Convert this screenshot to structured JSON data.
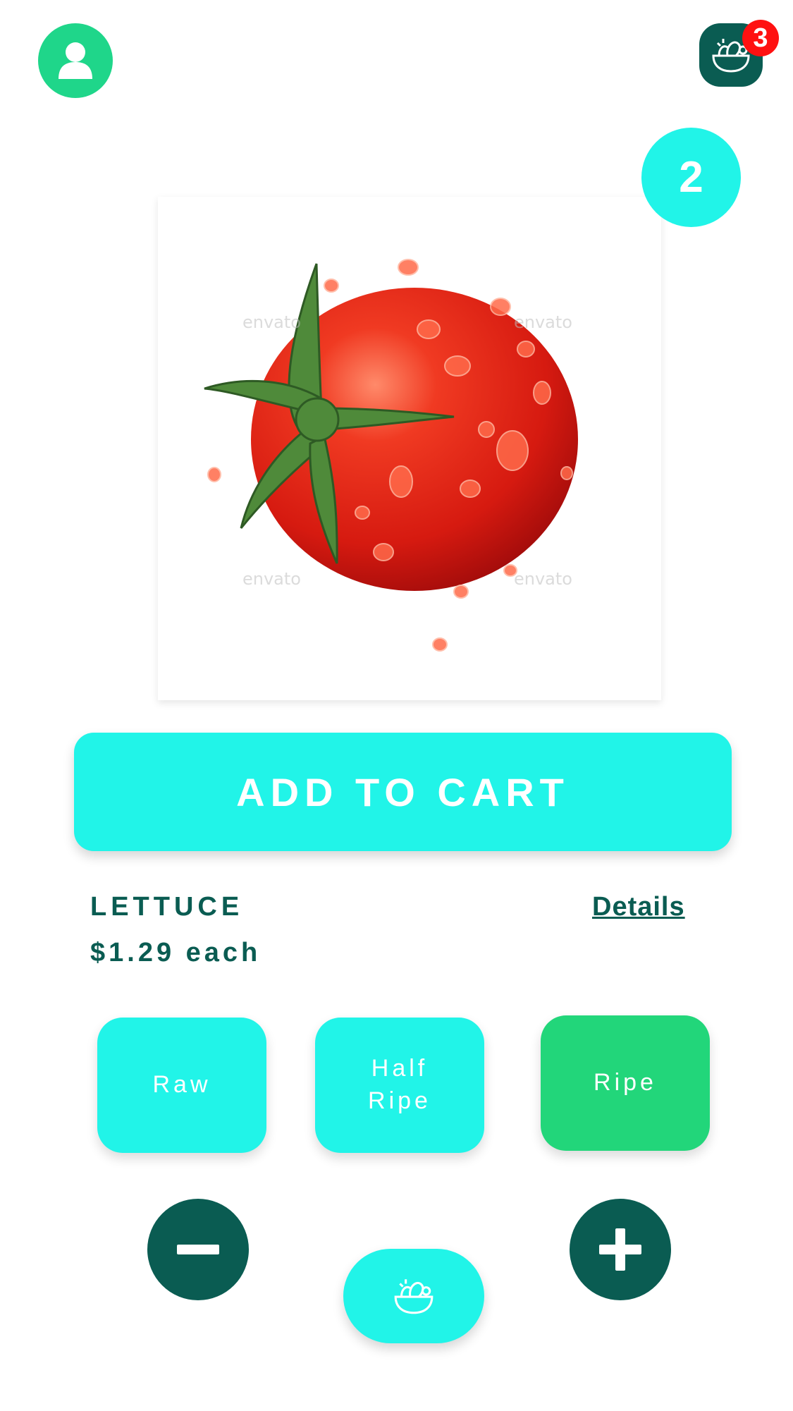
{
  "header": {
    "profile_icon": "user-icon",
    "cart_icon": "salad-bowl-icon",
    "cart_count": "3"
  },
  "product": {
    "image_subject": "tomato",
    "quantity": "2",
    "name": "LETTUCE",
    "price": "$1.29 each",
    "details_label": "Details",
    "watermark": "envato"
  },
  "actions": {
    "add_to_cart_label": "ADD TO CART"
  },
  "ripeness": {
    "options": [
      {
        "label": "Raw",
        "selected": false
      },
      {
        "label": "Half Ripe",
        "selected": false
      },
      {
        "label": "Ripe",
        "selected": true
      }
    ]
  },
  "stepper": {
    "minus_icon": "minus-icon",
    "plus_icon": "plus-icon",
    "fab_icon": "salad-bowl-icon"
  },
  "colors": {
    "accent_cyan": "#21f4e8",
    "accent_green": "#22d67a",
    "dark_teal": "#0a5c52",
    "badge_red": "#ff1111"
  }
}
